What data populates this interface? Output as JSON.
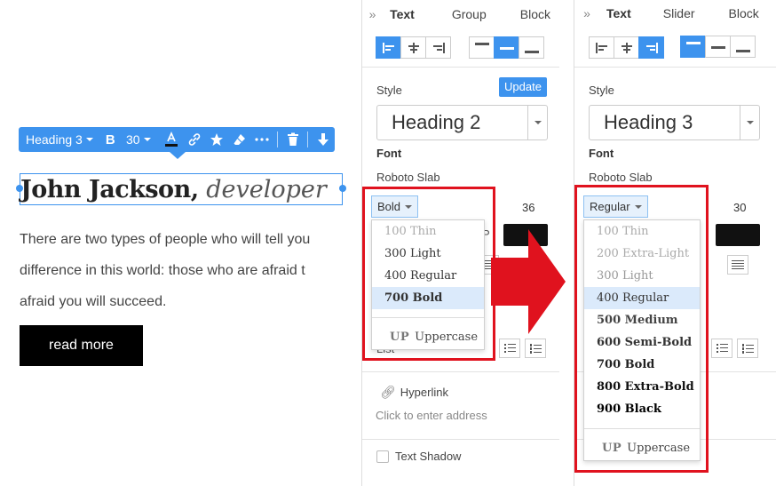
{
  "toolbar": {
    "heading": "Heading 3",
    "bold": "B",
    "size": "30"
  },
  "content": {
    "heading_name": "John Jackson,",
    "heading_role": "developer",
    "body_lines": [
      "There are two types of people who will tell you",
      "difference in this world: those who are afraid t",
      "afraid you will succeed."
    ],
    "button": "read more"
  },
  "panel_left": {
    "tabs": [
      "Text",
      "Group",
      "Block"
    ],
    "style_label": "Style",
    "update_label": "Update",
    "style_value": "Heading 2",
    "font_label": "Font",
    "font_value": "Roboto Slab",
    "weight_value": "Bold",
    "size_value": "36",
    "p_hint": "P",
    "weights": [
      "100 Thin",
      "300 Light",
      "400 Regular",
      "700 Bold"
    ],
    "selected_weight": "700 Bold",
    "uppercase_prefix": "UP",
    "uppercase_label": "Uppercase",
    "list_hint": "List",
    "hyperlink_label": "Hyperlink",
    "address_placeholder": "Click to enter address",
    "text_shadow_label": "Text Shadow"
  },
  "panel_right": {
    "tabs": [
      "Text",
      "Slider",
      "Block"
    ],
    "style_label": "Style",
    "style_value": "Heading 3",
    "font_label": "Font",
    "font_value": "Roboto Slab",
    "weight_value": "Regular",
    "size_value": "30",
    "weights": [
      "100 Thin",
      "200 Extra-Light",
      "300 Light",
      "400 Regular",
      "500 Medium",
      "600 Semi-Bold",
      "700 Bold",
      "800 Extra-Bold",
      "900 Black"
    ],
    "selected_weight": "400 Regular",
    "uppercase_prefix": "UP",
    "uppercase_label": "Uppercase"
  },
  "colors": {
    "accent": "#3d93ee",
    "highlight": "#e0121e",
    "text_color_swatch": "#111111"
  }
}
